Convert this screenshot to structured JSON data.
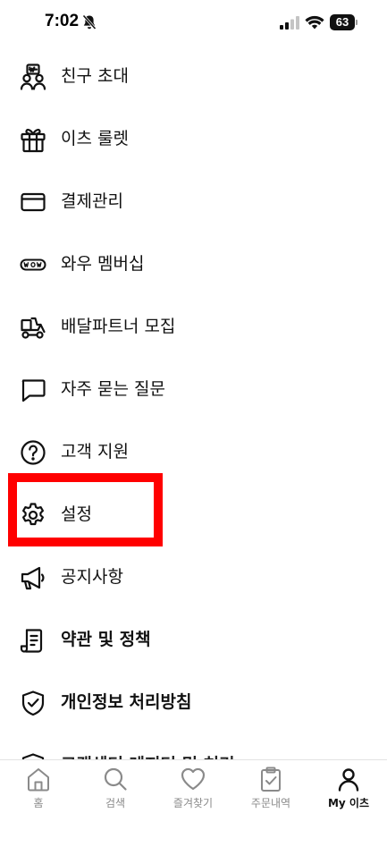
{
  "status_bar": {
    "time": "7:02",
    "battery": "63",
    "icons": [
      "bell-off-icon",
      "signal-icon",
      "wifi-icon",
      "battery-icon"
    ]
  },
  "menu": {
    "items": [
      {
        "label": "친구 초대",
        "icon": "invite-friends-icon"
      },
      {
        "label": "이츠 룰렛",
        "icon": "gift-icon"
      },
      {
        "label": "결제관리",
        "icon": "credit-card-icon"
      },
      {
        "label": "와우 멤버십",
        "icon": "wow-membership-icon"
      },
      {
        "label": "배달파트너 모집",
        "icon": "delivery-scooter-icon"
      },
      {
        "label": "자주 묻는 질문",
        "icon": "chat-bubble-icon"
      },
      {
        "label": "고객 지원",
        "icon": "help-circle-icon"
      },
      {
        "label": "설정",
        "icon": "gear-icon"
      },
      {
        "label": "공지사항",
        "icon": "megaphone-icon"
      },
      {
        "label": "약관 및 정책",
        "icon": "document-icon"
      },
      {
        "label": "개인정보 처리방침",
        "icon": "shield-check-icon"
      },
      {
        "label": "고객센터 레지터 및 처리",
        "icon": "shield-icon"
      }
    ]
  },
  "tab_bar": {
    "tabs": [
      {
        "label": "홈",
        "icon": "home-icon"
      },
      {
        "label": "검색",
        "icon": "search-icon"
      },
      {
        "label": "즐겨찾기",
        "icon": "heart-icon"
      },
      {
        "label": "주문내역",
        "icon": "order-list-icon"
      },
      {
        "label": "My 이츠",
        "icon": "person-icon"
      }
    ],
    "active_tab": "My 이츠"
  },
  "colors": {
    "highlight": "#ff0000",
    "tab_inactive": "#8a8a8a",
    "tab_active": "#111111"
  }
}
